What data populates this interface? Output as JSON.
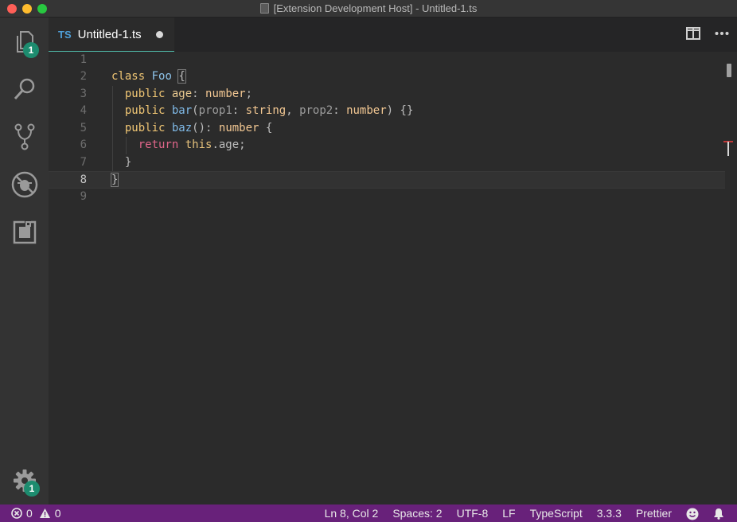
{
  "window": {
    "title": "[Extension Development Host] - Untitled-1.ts"
  },
  "activity": {
    "explorer_badge": "1",
    "settings_badge": "1"
  },
  "tab": {
    "lang_badge": "TS",
    "name": "Untitled-1.ts"
  },
  "editor": {
    "line_numbers": [
      "1",
      "2",
      "3",
      "4",
      "5",
      "6",
      "7",
      "8",
      "9"
    ],
    "tokens": {
      "l2": {
        "kw": "class",
        "name": "Foo",
        "brace": "{"
      },
      "l3": {
        "mod": "public",
        "prop": "age",
        "colon": ": ",
        "type": "number",
        "end": ";"
      },
      "l4": {
        "mod": "public",
        "fn": "bar",
        "open": "(",
        "p1": "prop1",
        "c1": ": ",
        "t1": "string",
        "comma": ", ",
        "p2": "prop2",
        "c2": ": ",
        "t2": "number",
        "close": ") {}"
      },
      "l5": {
        "mod": "public",
        "fn": "baz",
        "parens": "()",
        "colon": ": ",
        "type": "number",
        "brace": " {"
      },
      "l6": {
        "ret": "return",
        "this": "this",
        "rest": ".age;"
      },
      "l7": {
        "brace": "}"
      },
      "l8": {
        "brace": "}"
      }
    }
  },
  "status": {
    "errors": "0",
    "warnings": "0",
    "position": "Ln 8, Col 2",
    "spaces": "Spaces: 2",
    "encoding": "UTF-8",
    "eol": "LF",
    "language": "TypeScript",
    "version": "3.3.3",
    "formatter": "Prettier"
  },
  "colors": {
    "status_bar": "#68217a",
    "badge": "#1d8c6f",
    "tab_underline": "#4fb7a6"
  },
  "icons": [
    "files-icon",
    "search-icon",
    "source-control-icon",
    "debug-icon",
    "extensions-icon",
    "gear-icon",
    "split-editor-icon",
    "more-actions-icon",
    "error-icon",
    "warning-icon",
    "smiley-icon",
    "bell-icon"
  ]
}
